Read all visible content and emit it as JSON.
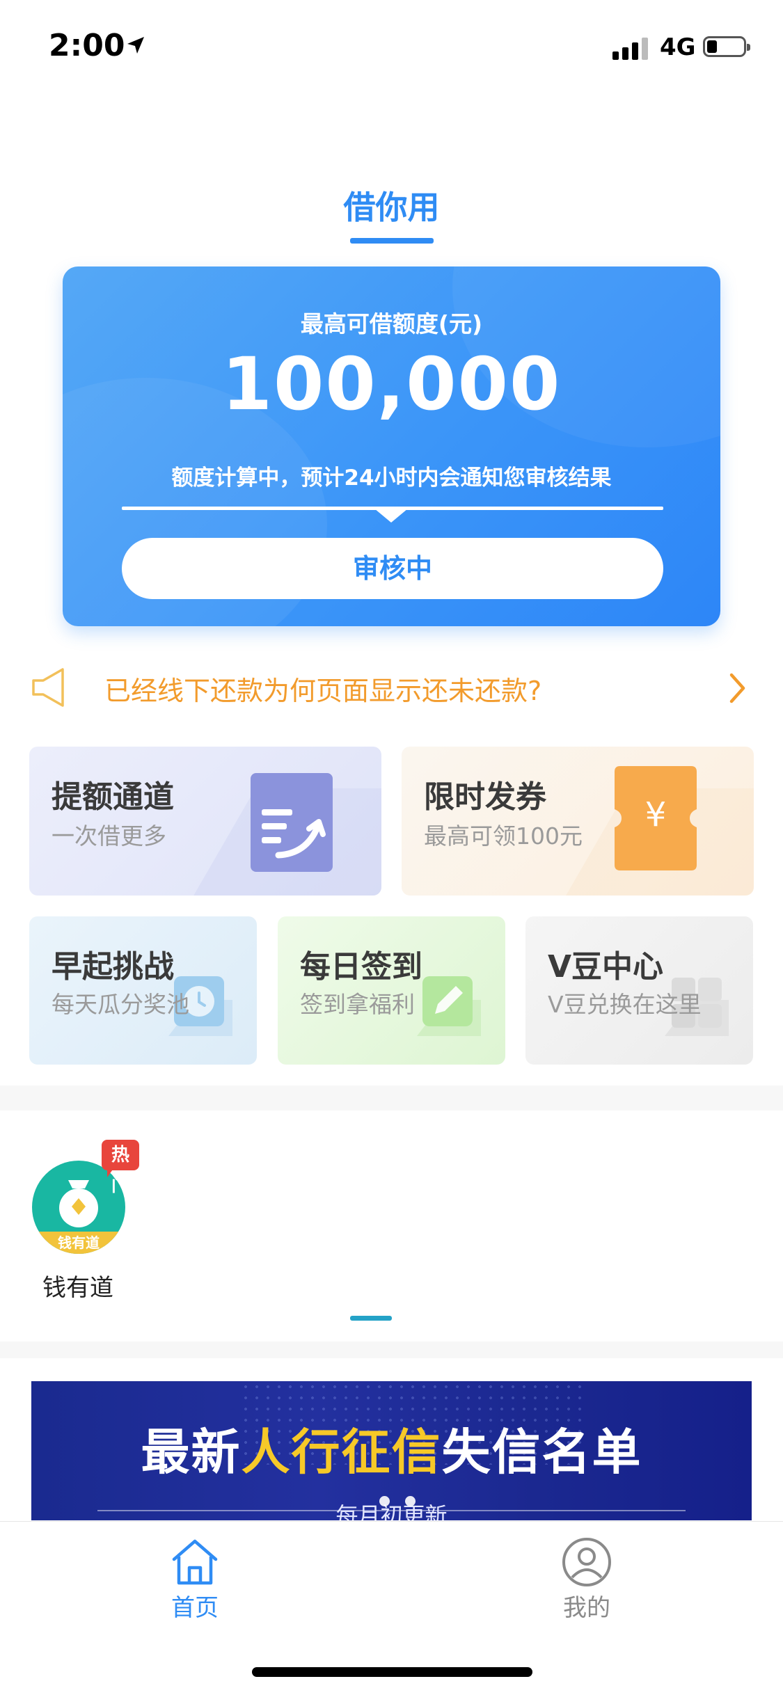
{
  "status_bar": {
    "time": "2:00",
    "network": "4G"
  },
  "header": {
    "title": "借你用"
  },
  "loan_card": {
    "limit_label": "最高可借额度(元)",
    "limit_amount": "100,000",
    "note": "额度计算中，预计24小时内会通知您审核结果",
    "button_label": "审核中"
  },
  "notice": {
    "text": "已经线下还款为何页面显示还未还款?"
  },
  "feature_tiles": [
    {
      "title": "提额通道",
      "subtitle": "一次借更多"
    },
    {
      "title": "限时发券",
      "subtitle": "最高可领100元"
    },
    {
      "title": "早起挑战",
      "subtitle": "每天瓜分奖池"
    },
    {
      "title": "每日签到",
      "subtitle": "签到拿福利"
    },
    {
      "title": "V豆中心",
      "subtitle": "V豆兑换在这里"
    }
  ],
  "apps": [
    {
      "name": "钱有道",
      "badge": "热门",
      "logo_text": "钱有道"
    }
  ],
  "banner": {
    "title_pre": "最新",
    "title_highlight": "人行征信",
    "title_post": "失信名单",
    "subtitle": "每月初更新"
  },
  "tab_bar": {
    "home_label": "首页",
    "mine_label": "我的"
  },
  "colors": {
    "accent": "#2f8cf4",
    "notice": "#f29b2c",
    "hot": "#e8453c"
  },
  "icons": [
    "location-arrow-icon",
    "signal-icon",
    "battery-icon",
    "speaker-icon",
    "chevron-right-icon",
    "document-up-icon",
    "coupon-ticket-icon",
    "alarm-clock-icon",
    "pencil-icon",
    "cube-icon",
    "home-icon",
    "user-icon"
  ]
}
